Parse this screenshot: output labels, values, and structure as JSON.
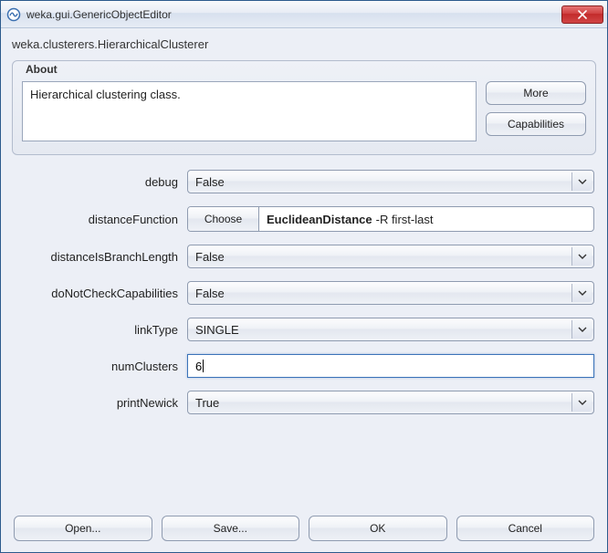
{
  "window": {
    "title": "weka.gui.GenericObjectEditor"
  },
  "classpath": "weka.clusterers.HierarchicalClusterer",
  "about": {
    "legend": "About",
    "description": "Hierarchical clustering class.",
    "more_label": "More",
    "capabilities_label": "Capabilities"
  },
  "props": {
    "debug": {
      "label": "debug",
      "value": "False"
    },
    "distanceFunction": {
      "label": "distanceFunction",
      "choose_label": "Choose",
      "value_name": "EuclideanDistance",
      "value_args": "-R first-last"
    },
    "distanceIsBranchLength": {
      "label": "distanceIsBranchLength",
      "value": "False"
    },
    "doNotCheckCapabilities": {
      "label": "doNotCheckCapabilities",
      "value": "False"
    },
    "linkType": {
      "label": "linkType",
      "value": "SINGLE"
    },
    "numClusters": {
      "label": "numClusters",
      "value": "6"
    },
    "printNewick": {
      "label": "printNewick",
      "value": "True"
    }
  },
  "buttons": {
    "open": "Open...",
    "save": "Save...",
    "ok": "OK",
    "cancel": "Cancel"
  }
}
